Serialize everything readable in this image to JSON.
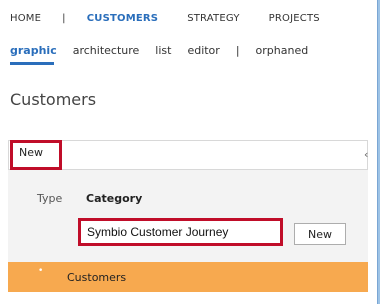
{
  "nav": {
    "items": [
      {
        "label": "HOME"
      },
      {
        "label": "|"
      },
      {
        "label": "CUSTOMERS"
      },
      {
        "label": "STRATEGY"
      },
      {
        "label": "PROJECTS"
      }
    ]
  },
  "subtabs": {
    "items": [
      {
        "label": "graphic"
      },
      {
        "label": "architecture"
      },
      {
        "label": "list"
      },
      {
        "label": "editor"
      },
      {
        "label": "|"
      },
      {
        "label": "orphaned"
      }
    ]
  },
  "page": {
    "title": "Customers"
  },
  "toolbar": {
    "new_label": "New",
    "collapse_icon": "chevron-left-icon"
  },
  "form": {
    "type_label": "Type",
    "type_value": "Category",
    "name_value": "Symbio Customer Journey",
    "new_button_label": "New"
  },
  "tree": {
    "item_label": "Customers",
    "item_bullet": "•",
    "highlight_color": "#f7a94f"
  },
  "colors": {
    "accent": "#2a6ebb",
    "annotation": "#c00d29"
  }
}
